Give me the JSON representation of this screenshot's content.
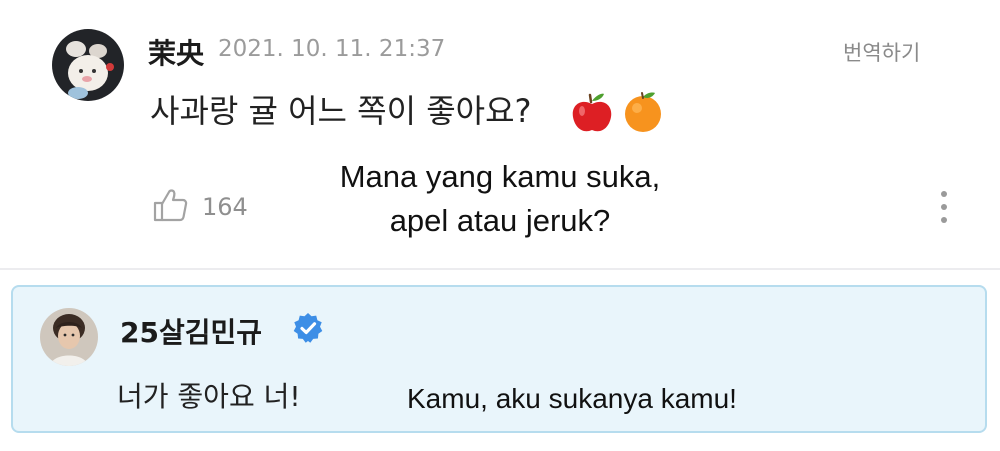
{
  "comment": {
    "author": "茉央",
    "timestamp": "2021. 10. 11. 21:37",
    "translate_label": "번역하기",
    "text": "사과랑 귤 어느 쪽이 좋아요?",
    "emojis": [
      "apple-emoji",
      "orange-emoji"
    ],
    "like_count": "164",
    "overlay_translation": {
      "line1": "Mana yang kamu suka,",
      "line2": "apel atau jeruk?"
    }
  },
  "reply": {
    "author": "25살김민규",
    "verified": true,
    "text": "너가 좋아요 너!",
    "overlay_translation": "Kamu, aku sukanya kamu!"
  },
  "colors": {
    "reply_background": "#e9f5fb",
    "reply_border": "#b6dcee",
    "verified_badge": "#3d8ee6",
    "secondary_text": "#9b9b9b"
  }
}
